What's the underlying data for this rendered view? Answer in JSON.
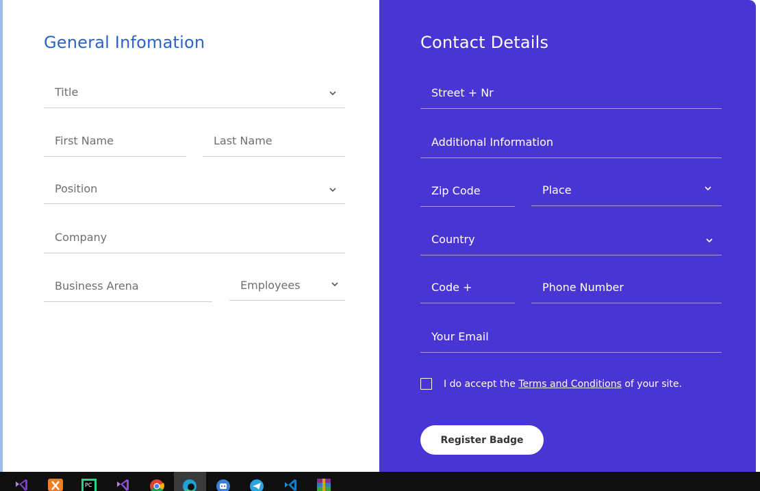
{
  "general": {
    "heading": "General Infomation",
    "title_label": "Title",
    "first_name_label": "First Name",
    "last_name_label": "Last Name",
    "position_label": "Position",
    "company_label": "Company",
    "business_arena_label": "Business Arena",
    "employees_label": "Employees"
  },
  "contact": {
    "heading": "Contact Details",
    "street_label": "Street + Nr",
    "additional_info_label": "Additional Information",
    "zip_label": "Zip Code",
    "place_label": "Place",
    "country_label": "Country",
    "code_label": "Code +",
    "phone_label": "Phone Number",
    "email_label": "Your Email",
    "terms_prefix": "I do accept the",
    "terms_link": "Terms and Conditions",
    "terms_suffix": "of your site.",
    "register_button": "Register Badge"
  },
  "colors": {
    "left_heading": "#2b63c6",
    "right_panel": "#4835d4",
    "taskbar": "#0f0f0f"
  },
  "taskbar": {
    "icons": [
      "visual-studio-icon",
      "xampp-icon",
      "pycharm-icon",
      "visual-studio-2-icon",
      "chrome-icon",
      "edge-icon",
      "bot-app-icon",
      "telegram-icon",
      "vscode-icon",
      "winrar-icon"
    ]
  }
}
